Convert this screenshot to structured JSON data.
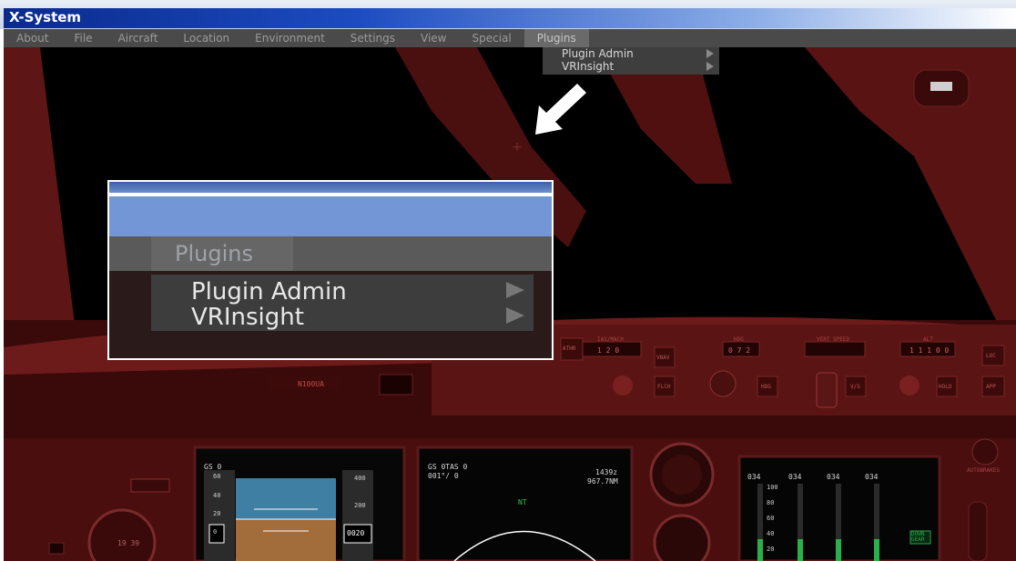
{
  "window": {
    "title": "X-System"
  },
  "menu": [
    {
      "label": "About"
    },
    {
      "label": "File"
    },
    {
      "label": "Aircraft"
    },
    {
      "label": "Location"
    },
    {
      "label": "Environment"
    },
    {
      "label": "Settings"
    },
    {
      "label": "View"
    },
    {
      "label": "Special"
    },
    {
      "label": "Plugins"
    }
  ],
  "plugins_dropdown": {
    "items": [
      {
        "label": "Plugin Admin"
      },
      {
        "label": "VRInsight"
      }
    ]
  },
  "zoom_callout": {
    "menu_label": "Plugins",
    "items": [
      {
        "label": "Plugin Admin"
      },
      {
        "label": "VRInsight"
      }
    ]
  },
  "cockpit": {
    "tail_number": "N100UA",
    "mcp": {
      "ias_mach": "IAS/MACH",
      "hdg": "HDG",
      "vert_speed": "VERT SPEED",
      "alt": "ALT",
      "speed_val": "1 2 0",
      "hdg_val": "0 7 2",
      "alt_val": "1 1 1 0 0",
      "flch": "FLCH",
      "vnav": "VNAV",
      "athr": "ATHR",
      "hold": "HOLD",
      "app": "APP",
      "vs": "V/S",
      "loc": "LOC"
    },
    "pfd": {
      "gs": "GS  0",
      "tape": [
        "60",
        "40",
        "20",
        "0"
      ],
      "alt_tape": [
        "400",
        "200"
      ],
      "alt_box": "0020"
    },
    "nd": {
      "gs_tas": "GS  0TAS  0",
      "course": "001°/  0",
      "time": "1439z",
      "dist": "967.7NM",
      "heading": "NT"
    },
    "eicas": {
      "columns": [
        "034",
        "034",
        "034",
        "034"
      ],
      "scale": [
        "100",
        "80",
        "60",
        "40",
        "20"
      ],
      "gear": "DOWN\nGEAR"
    },
    "lower_left": {
      "value": "19 39"
    },
    "autobrake_label": "AUTOBRAKES"
  }
}
